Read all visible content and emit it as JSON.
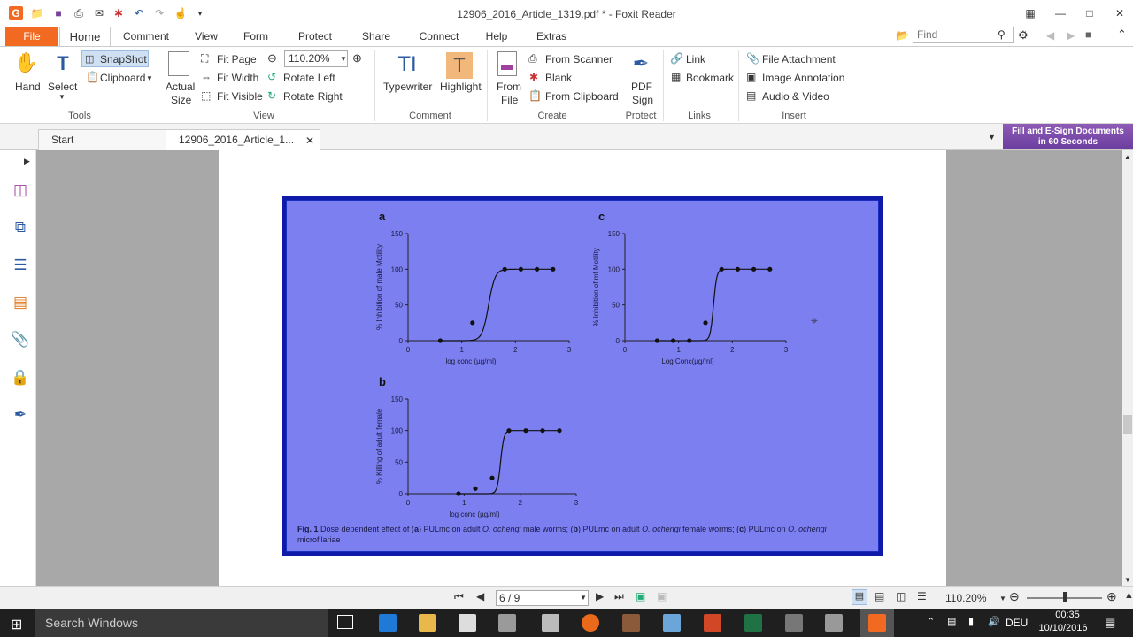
{
  "window": {
    "title": "12906_2016_Article_1319.pdf * - Foxit Reader"
  },
  "menu_tabs": [
    "File",
    "Home",
    "Comment",
    "View",
    "Form",
    "Protect",
    "Share",
    "Connect",
    "Help",
    "Extras"
  ],
  "search": {
    "placeholder": "Find"
  },
  "ribbon": {
    "tools": {
      "hand": "Hand",
      "select": "Select",
      "snapshot": "SnapShot",
      "clipboard": "Clipboard",
      "group": "Tools"
    },
    "view": {
      "actual_size_1": "Actual",
      "actual_size_2": "Size",
      "fit_page": "Fit Page",
      "fit_width": "Fit Width",
      "fit_visible": "Fit Visible",
      "zoom": "110.20%",
      "rotate_left": "Rotate Left",
      "rotate_right": "Rotate Right",
      "group": "View"
    },
    "comment": {
      "typewriter": "Typewriter",
      "highlight": "Highlight",
      "group": "Comment"
    },
    "create": {
      "from_file_1": "From",
      "from_file_2": "File",
      "from_scanner": "From Scanner",
      "blank": "Blank",
      "from_clipboard": "From Clipboard",
      "group": "Create"
    },
    "protect": {
      "pdf_sign_1": "PDF",
      "pdf_sign_2": "Sign",
      "group": "Protect"
    },
    "links": {
      "link": "Link",
      "bookmark": "Bookmark",
      "group": "Links"
    },
    "insert": {
      "file_attachment": "File Attachment",
      "image_annotation": "Image Annotation",
      "audio_video": "Audio & Video",
      "group": "Insert"
    }
  },
  "doc_tabs": {
    "start": "Start",
    "article": "12906_2016_Article_1..."
  },
  "promo": {
    "line1": "Fill and E-Sign Documents",
    "line2": "in 60 Seconds"
  },
  "figure": {
    "panels": [
      {
        "letter": "a",
        "ylabel": "% Inhibition of male Motility",
        "xlabel": "log conc (µg/ml)"
      },
      {
        "letter": "b",
        "ylabel": "% Killing of adult female",
        "xlabel": "log conc (µg/ml)"
      },
      {
        "letter": "c",
        "ylabel": "% Inhibition of mf Motility",
        "xlabel": "Log Conc(µg/ml)"
      }
    ],
    "yticks": [
      "0",
      "50",
      "100",
      "150"
    ],
    "xticks": [
      "0",
      "1",
      "2",
      "3"
    ],
    "caption": {
      "label": "Fig. 1",
      "text1": " Dose dependent effect of (",
      "a": "a",
      "text2": ") PULmc on adult ",
      "sp1": "O. ochengi",
      "text3": " male worms; (",
      "b": "b",
      "text4": ") PULmc on adult ",
      "sp2": "O. ochengi",
      "text5": " female worms; (",
      "c": "c",
      "text6": ") PULmc on ",
      "sp3": "O. ochengi",
      "text7": " microfilariae"
    }
  },
  "chart_data": [
    {
      "type": "scatter",
      "title": "a",
      "xlabel": "log conc (µg/ml)",
      "ylabel": "% Inhibition of male Motility",
      "xlim": [
        0,
        3
      ],
      "ylim": [
        0,
        150
      ],
      "x": [
        0.6,
        1.2,
        1.8,
        2.1,
        2.4,
        2.7
      ],
      "y": [
        0,
        25,
        100,
        100,
        100,
        100
      ],
      "curve": "sigmoid"
    },
    {
      "type": "scatter",
      "title": "b",
      "xlabel": "log conc (µg/ml)",
      "ylabel": "% Killing of adult female",
      "xlim": [
        0,
        3
      ],
      "ylim": [
        0,
        150
      ],
      "x": [
        0.9,
        1.2,
        1.5,
        1.8,
        2.1,
        2.4,
        2.7
      ],
      "y": [
        0,
        8,
        25,
        100,
        100,
        100,
        100
      ],
      "curve": "sigmoid"
    },
    {
      "type": "scatter",
      "title": "c",
      "xlabel": "Log Conc(µg/ml)",
      "ylabel": "% Inhibition of mf Motility",
      "xlim": [
        0,
        3
      ],
      "ylim": [
        0,
        150
      ],
      "x": [
        0.6,
        0.9,
        1.2,
        1.5,
        1.8,
        2.1,
        2.4,
        2.7
      ],
      "y": [
        0,
        0,
        0,
        25,
        100,
        100,
        100,
        100
      ],
      "curve": "sigmoid"
    }
  ],
  "status": {
    "page": "6 / 9",
    "zoom": "110.20%"
  },
  "taskbar": {
    "search": "Search Windows",
    "lang": "DEU",
    "time": "00:35",
    "date": "10/10/2016"
  }
}
